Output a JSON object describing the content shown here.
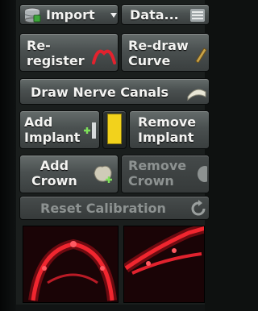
{
  "toolbar": {
    "import_label": "Import",
    "data_label": "Data..."
  },
  "buttons": {
    "reregister": "Re-\nregister",
    "redraw": "Re-draw\nCurve",
    "draw_nerve": "Draw Nerve Canals",
    "add_implant": "Add\nImplant",
    "remove_implant": "Remove\nImplant",
    "add_crown": "Add\nCrown",
    "remove_crown": "Remove\nCrown",
    "reset_calibration": "Reset Calibration"
  },
  "colors": {
    "accent_yellow": "#f2d21c",
    "accent_red": "#e2222e",
    "accent_green": "#7ee05a"
  },
  "icons": [
    "database-icon",
    "chevron-down-icon",
    "grid-icon",
    "register-icon",
    "pencil-icon",
    "tooth-arch-icon",
    "implant-add-icon",
    "crown-add-icon",
    "crown-remove-icon",
    "reset-icon"
  ]
}
